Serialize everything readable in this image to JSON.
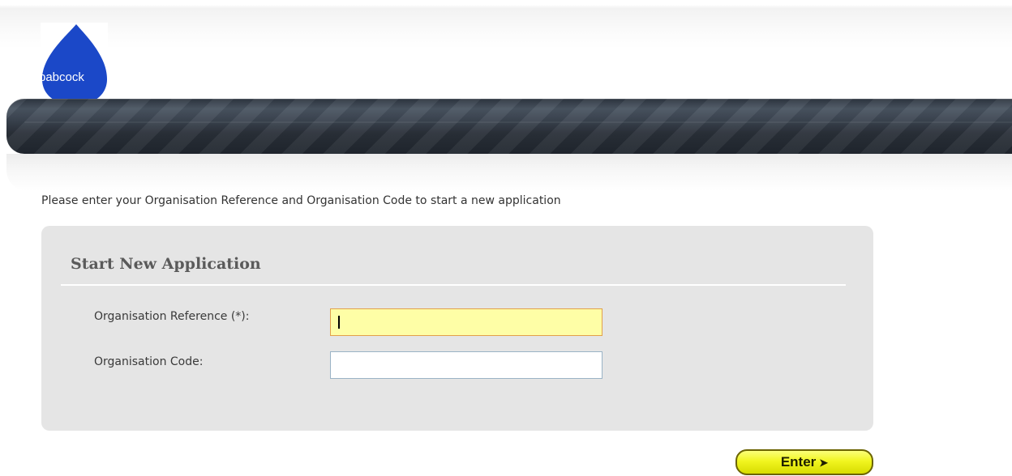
{
  "logo": {
    "text": "babcock",
    "color": "#1b48c8"
  },
  "instructions": "Please enter your Organisation Reference and Organisation Code to start a new application",
  "form": {
    "title": "Start New Application",
    "fields": [
      {
        "label": "Organisation Reference (*):",
        "value": "",
        "focused": true
      },
      {
        "label": "Organisation Code:",
        "value": "",
        "focused": false
      }
    ]
  },
  "submit": {
    "label": "Enter",
    "icon": "arrow-right-icon"
  },
  "colors": {
    "panel": "#e5e5e5",
    "button": "#f1f520",
    "focused_field": "#fefea6"
  }
}
